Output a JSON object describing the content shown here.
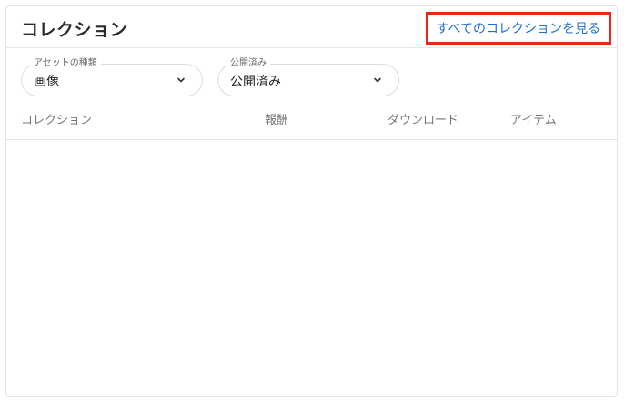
{
  "header": {
    "title": "コレクション",
    "view_all_label": "すべてのコレクションを見る"
  },
  "filters": {
    "asset_type": {
      "label": "アセットの種類",
      "value": "画像"
    },
    "publish_status": {
      "label": "公開済み",
      "value": "公開済み"
    }
  },
  "table": {
    "columns": [
      "コレクション",
      "報酬",
      "ダウンロード",
      "アイテム"
    ],
    "rows": []
  },
  "icons": {
    "dropdown": "chevron-down-icon"
  },
  "colors": {
    "link": "#1f6fd0",
    "highlight_border": "#e8261a"
  }
}
